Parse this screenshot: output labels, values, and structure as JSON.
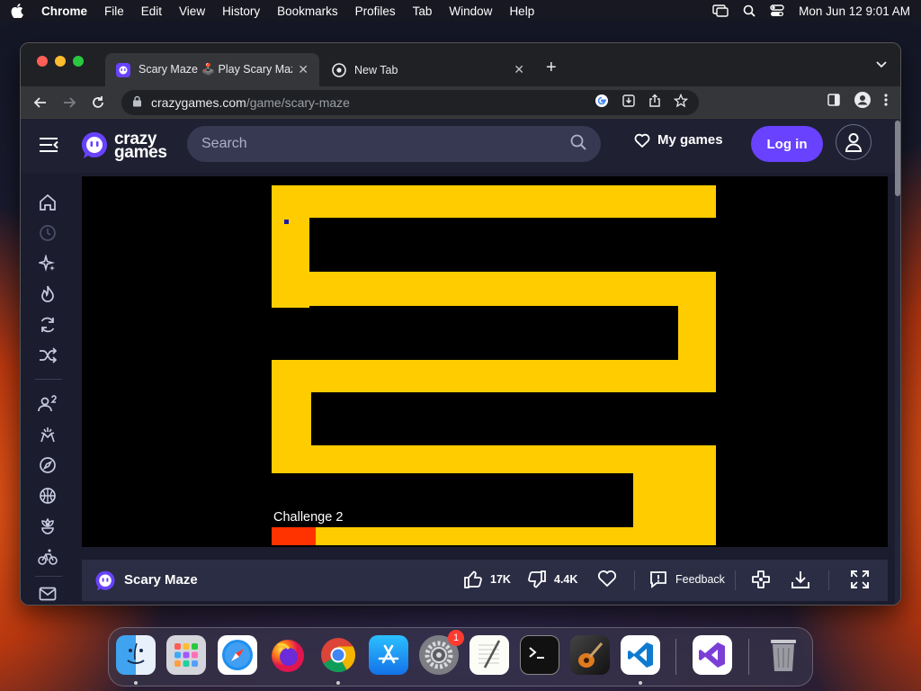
{
  "menubar": {
    "app": "Chrome",
    "items": [
      "File",
      "Edit",
      "View",
      "History",
      "Bookmarks",
      "Profiles",
      "Tab",
      "Window",
      "Help"
    ],
    "clock": "Mon Jun 12  9:01 AM"
  },
  "browser": {
    "tabs": [
      {
        "title": "Scary Maze 🕹️ Play Scary Maz",
        "close": "✕"
      },
      {
        "title": "New Tab",
        "close": "✕"
      }
    ],
    "new_tab": "+",
    "url_host": "crazygames.com",
    "url_path": "/game/scary-maze"
  },
  "site": {
    "logo_line1": "crazy",
    "logo_line2": "games",
    "search_placeholder": "Search",
    "my_games": "My games",
    "login": "Log in",
    "accent": "#6842ff"
  },
  "sidebar_icons": [
    "home-icon",
    "recent-icon",
    "new-icon",
    "trending-icon",
    "updated-icon",
    "random-icon",
    "multiplayer-icon",
    "io-icon",
    "adventure-icon",
    "basketball-icon",
    "casual-icon",
    "cycling-icon",
    "mail-icon"
  ],
  "game": {
    "maze_color": "#ffcc00",
    "danger_color": "#ff3300",
    "level_label": "Challenge 2"
  },
  "gamebar": {
    "title": "Scary Maze",
    "likes": "17K",
    "dislikes": "4.4K",
    "feedback": "Feedback"
  },
  "dock": {
    "apps": [
      "Finder",
      "Launchpad",
      "Safari",
      "Firefox",
      "Chrome",
      "App Store",
      "System Settings",
      "TextEdit",
      "Terminal",
      "GarageBand",
      "Visual Studio Code",
      "Visual Studio",
      "Trash"
    ],
    "settings_badge": "1"
  }
}
